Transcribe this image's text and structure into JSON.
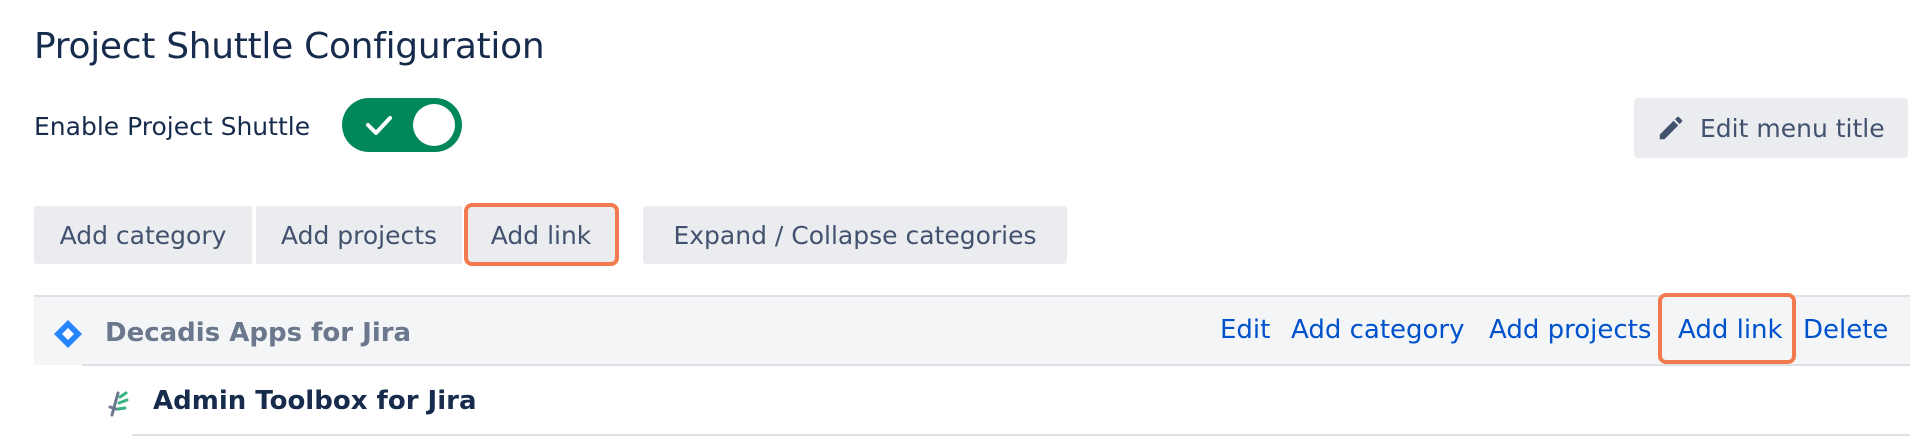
{
  "page": {
    "title": "Project Shuttle Configuration"
  },
  "enable": {
    "label": "Enable Project Shuttle",
    "toggle_on": true,
    "toggle_color": "#00875a"
  },
  "header_actions": {
    "edit_menu_title_label": "Edit menu title",
    "edit_menu_title_icon": "pencil-icon"
  },
  "toolbar": {
    "add_category_label": "Add category",
    "add_projects_label": "Add projects",
    "add_link_label": "Add link",
    "expand_collapse_label": "Expand / Collapse categories"
  },
  "tree": {
    "category": {
      "icon": "jira-icon",
      "name": "Decadis Apps for Jira",
      "actions": {
        "edit": "Edit",
        "add_category": "Add category",
        "add_projects": "Add projects",
        "add_link": "Add link",
        "delete": "Delete"
      }
    },
    "items": [
      {
        "icon": "app-logo-icon",
        "name": "Admin Toolbox for Jira"
      }
    ]
  },
  "colors": {
    "highlight": "#f27a4e",
    "link": "#0052cc",
    "button_bg": "#ebecf0",
    "jira_blue": "#2684ff"
  }
}
